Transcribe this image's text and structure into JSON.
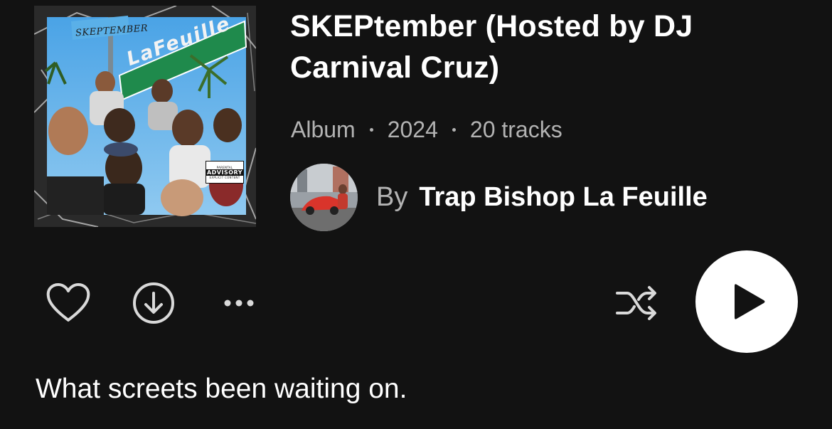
{
  "album": {
    "title": "SKEPtember (Hosted by DJ Carnival Cruz)",
    "type": "Album",
    "year": "2024",
    "track_count": "20 tracks",
    "cover": {
      "logo_text": "SKEPTEMBER",
      "sign_text": "LaFeuille",
      "advisory": {
        "top": "PARENTAL",
        "main": "ADVISORY",
        "bottom": "EXPLICIT CONTENT"
      }
    }
  },
  "artist": {
    "by_label": "By",
    "name": "Trap Bishop La Feuille"
  },
  "actions": {
    "like_icon": "heart-outline-icon",
    "download_icon": "download-circle-icon",
    "more_icon": "more-horizontal-icon",
    "shuffle_icon": "shuffle-icon",
    "play_icon": "play-icon"
  },
  "description": "What screets been waiting on.",
  "colors": {
    "background": "#121212",
    "primary_text": "#ffffff",
    "secondary_text": "#b3b3b3",
    "icon": "#d9d9d9",
    "play_button": "#ffffff",
    "play_glyph": "#121212"
  }
}
